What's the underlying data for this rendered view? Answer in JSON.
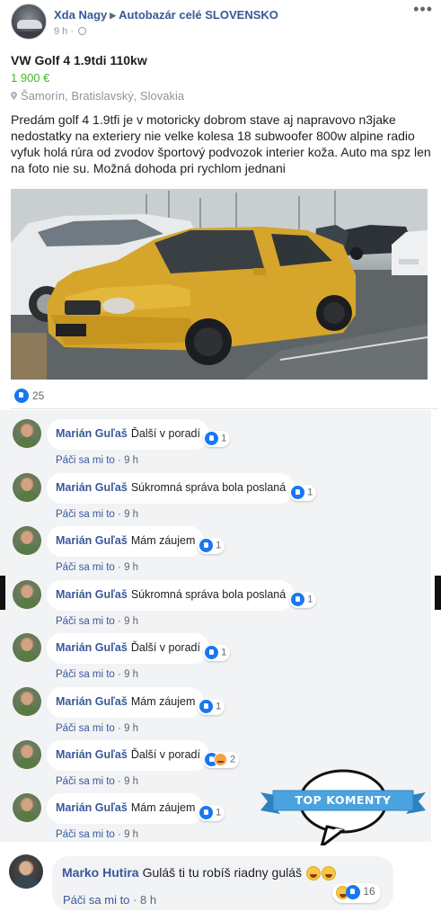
{
  "post": {
    "author": "Xda Nagy",
    "group": "Autobazár celé SLOVENSKO",
    "time": "9 h ·",
    "title": "VW Golf 4 1.9tdi 110kw",
    "price": "1 900 €",
    "location": "Šamorín, Bratislavský, Slovakia",
    "description": "Predám golf 4 1.9tfi je v motoricky dobrom stave aj napravovo n3jake nedostatky na exteriery nie velke kolesa 18 subwoofer 800w alpine radio vyfuk holá rúra od zvodov športový podvozok interier koža. Auto ma spz len na foto nie su. Možná dohoda pri rychlom jednani",
    "photo_icon": "yellow-vw-golf-photo",
    "reactions_count": "25"
  },
  "comments": [
    {
      "author": "Marián Guľaš",
      "text": "Ďalší v poradí",
      "reactions": "1",
      "like_label": "Páči sa mi to",
      "time": "9 h"
    },
    {
      "author": "Marián Guľaš",
      "text": "Súkromná správa bola poslaná",
      "reactions": "1",
      "like_label": "Páči sa mi to",
      "time": "9 h"
    },
    {
      "author": "Marián Guľaš",
      "text": "Mám záujem",
      "reactions": "1",
      "like_label": "Páči sa mi to",
      "time": "9 h"
    },
    {
      "author": "Marián Guľaš",
      "text": "Súkromná správa bola poslaná",
      "reactions": "1",
      "like_label": "Páči sa mi to",
      "time": "9 h"
    },
    {
      "author": "Marián Guľaš",
      "text": "Ďalší v poradí",
      "reactions": "1",
      "like_label": "Páči sa mi to",
      "time": "9 h"
    },
    {
      "author": "Marián Guľaš",
      "text": "Mám záujem",
      "reactions": "1",
      "like_label": "Páči sa mi to",
      "time": "9 h"
    },
    {
      "author": "Marián Guľaš",
      "text": "Ďalší v poradí",
      "reactions": "2",
      "like_label": "Páči sa mi to",
      "time": "9 h"
    },
    {
      "author": "Marián Guľaš",
      "text": "Mám záujem",
      "reactions": "1",
      "like_label": "Páči sa mi to",
      "time": "9 h"
    }
  ],
  "top_badge": "TOP KOMENTY",
  "last_comment": {
    "author": "Marko Hutira",
    "text": "Guláš ti tu robíš riadny guláš",
    "reactions": "16",
    "like_label": "Páči sa mi to",
    "time": "8 h"
  },
  "colors": {
    "link": "#385898",
    "price": "#42b72a",
    "like": "#1877f2",
    "car": "#d9a72a",
    "badge": "#4aa3df"
  }
}
